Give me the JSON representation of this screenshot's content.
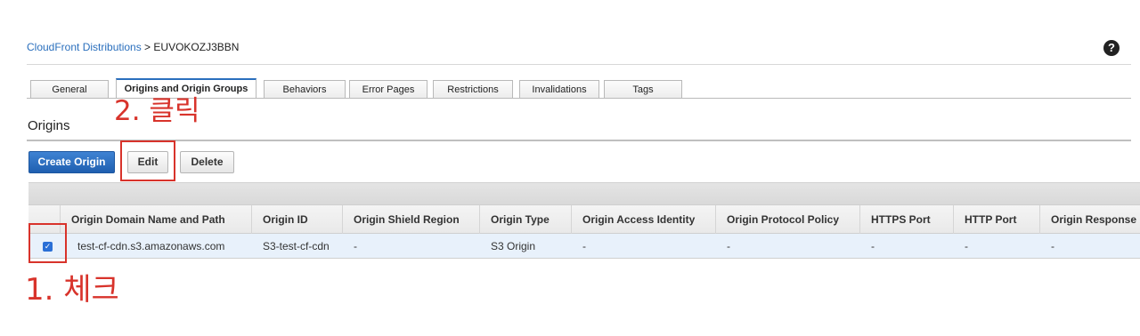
{
  "breadcrumb": {
    "link": "CloudFront Distributions",
    "separator": " > ",
    "current": "EUVOKOZJ3BBN"
  },
  "help_icon": "?",
  "tabs": [
    {
      "label": "General",
      "active": false
    },
    {
      "label": "Origins and Origin Groups",
      "active": true
    },
    {
      "label": "Behaviors",
      "active": false
    },
    {
      "label": "Error Pages",
      "active": false
    },
    {
      "label": "Restrictions",
      "active": false
    },
    {
      "label": "Invalidations",
      "active": false
    },
    {
      "label": "Tags",
      "active": false
    }
  ],
  "section": {
    "title": "Origins"
  },
  "buttons": {
    "create": "Create Origin",
    "edit": "Edit",
    "delete": "Delete"
  },
  "table": {
    "columns": [
      "Origin Domain Name and Path",
      "Origin ID",
      "Origin Shield Region",
      "Origin Type",
      "Origin Access Identity",
      "Origin Protocol Policy",
      "HTTPS Port",
      "HTTP Port",
      "Origin Response"
    ],
    "rows": [
      {
        "checked": true,
        "cells": [
          "test-cf-cdn.s3.amazonaws.com",
          "S3-test-cf-cdn",
          "-",
          "S3 Origin",
          "-",
          "-",
          "-",
          "-",
          "-"
        ]
      }
    ]
  },
  "annotations": {
    "step2": "2. 클릭",
    "step1": "1. 체크",
    "color": "#d8332b"
  },
  "colors": {
    "primary": "#2a6fbd",
    "selected_row": "#e8f1fb"
  }
}
